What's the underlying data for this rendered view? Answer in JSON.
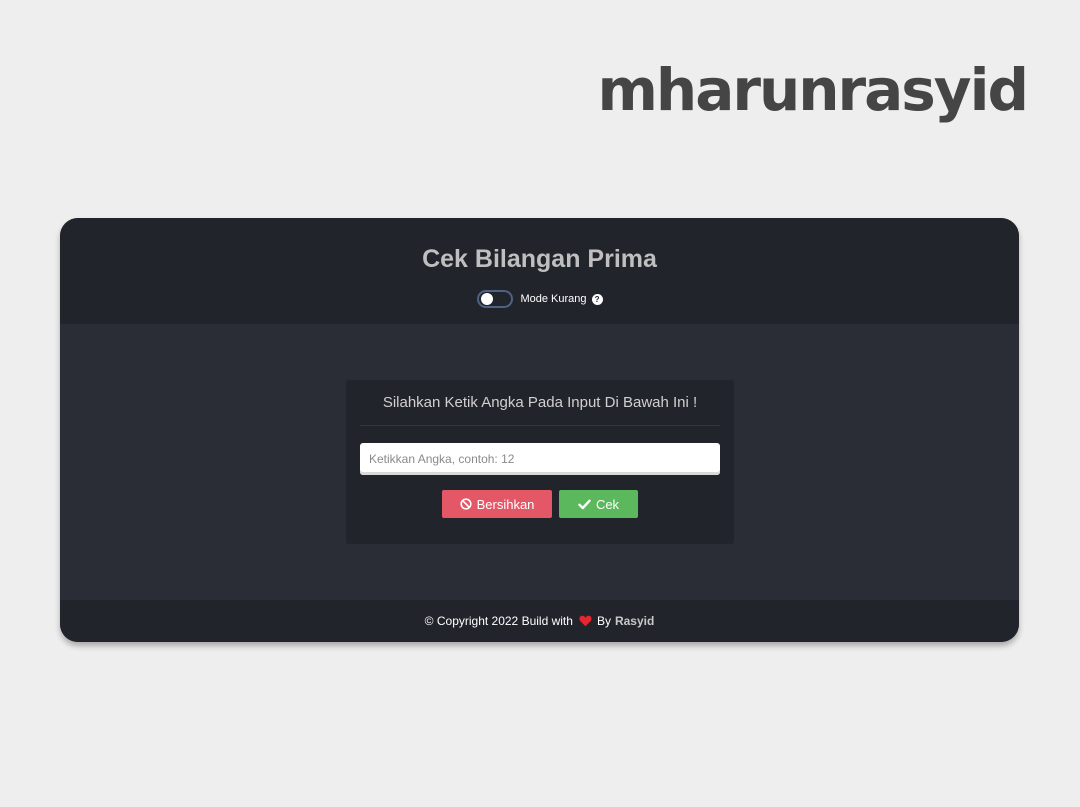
{
  "brand": {
    "name": "mharunrasyid"
  },
  "card": {
    "title": "Cek Bilangan Prima",
    "mode_toggle": {
      "label": "Mode Kurang",
      "checked": false,
      "help_icon": "question-circle-icon"
    },
    "instruction": "Silahkan Ketik Angka Pada Input Di Bawah Ini !",
    "input": {
      "placeholder": "Ketikkan Angka, contoh: 12",
      "value": ""
    },
    "buttons": {
      "clear_label": "Bersihkan",
      "clear_icon": "ban-icon",
      "check_label": "Cek",
      "check_icon": "check-icon"
    }
  },
  "footer": {
    "prefix": "© Copyright 2022 Build with",
    "heart_icon": "heart-icon",
    "by": "By",
    "author": "Rasyid"
  },
  "colors": {
    "background": "#eeeeee",
    "card_dark": "#22242b",
    "card_body": "#2a2d35",
    "danger": "#e35766",
    "success": "#5cb85c",
    "heart": "#e5262e"
  }
}
